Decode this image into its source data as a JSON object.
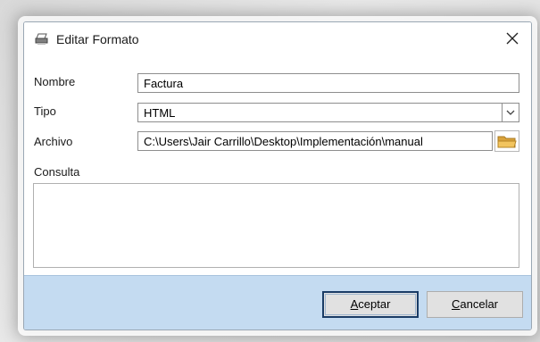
{
  "window": {
    "title": "Editar Formato",
    "icon": "printer-icon",
    "close_icon": "close-icon"
  },
  "form": {
    "nombre": {
      "label": "Nombre",
      "value": "Factura"
    },
    "tipo": {
      "label": "Tipo",
      "value": "HTML"
    },
    "archivo": {
      "label": "Archivo",
      "value": "C:\\Users\\Jair Carrillo\\Desktop\\Implementación\\manual",
      "browse_icon": "folder-icon"
    },
    "consulta": {
      "label": "Consulta",
      "value": ""
    }
  },
  "buttons": {
    "accept": {
      "mnemonic": "A",
      "rest": "ceptar"
    },
    "cancel": {
      "mnemonic": "C",
      "rest": "ancelar"
    }
  },
  "colors": {
    "footer": "#c4dbf1",
    "primary_border": "#1a3c66",
    "folder": "#e8b64a"
  }
}
